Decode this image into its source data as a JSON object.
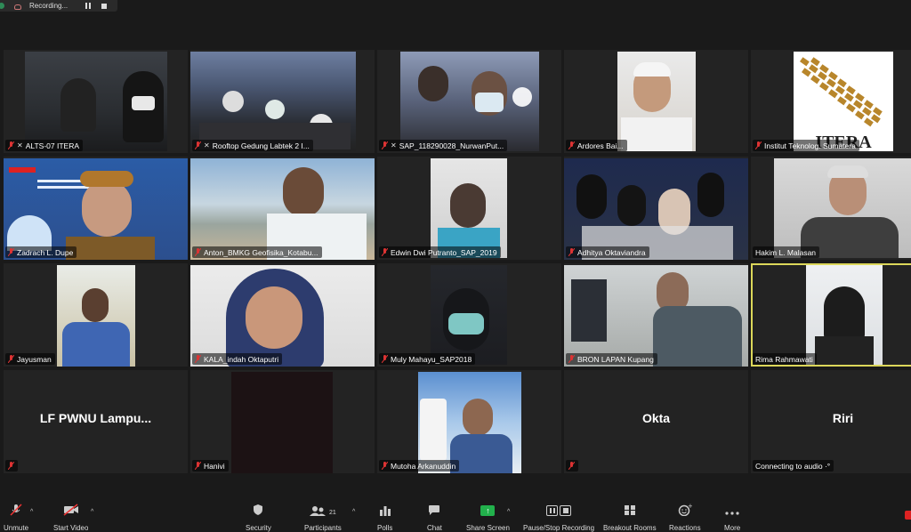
{
  "recording": {
    "label": "Recording..."
  },
  "participants": [
    {
      "name": "ALTS-07 ITERA"
    },
    {
      "name": "Rooftop Gedung Labtek 2 I..."
    },
    {
      "name": "SAP_118290028_NurwanPut..."
    },
    {
      "name": "Ardores Bai..."
    },
    {
      "name": "Institut Teknolog. Sumatera",
      "logo_text": "ITERA"
    },
    {
      "name": "Zadrach L. Dupe"
    },
    {
      "name": "Anton_BMKG Geofisika_Kotabu..."
    },
    {
      "name": "Edwin Dwi Putranto_SAP_2019"
    },
    {
      "name": "Adhitya Oktaviandra"
    },
    {
      "name": "Hakim L. Malasan"
    },
    {
      "name": "Jayusman"
    },
    {
      "name": "KALA_indah Oktaputri"
    },
    {
      "name": "Muly Mahayu_SAP2018"
    },
    {
      "name": "BRON LAPAN Kupang"
    },
    {
      "name": "Rima Rahmawati"
    },
    {
      "name": "LF PWNU Lampu..."
    },
    {
      "name": "Hanivi"
    },
    {
      "name": "Mutoha Arkanuddin"
    },
    {
      "name": "Okta"
    },
    {
      "name": "Riri",
      "status": "Connecting to audio ·°"
    }
  ],
  "toolbar": {
    "unmute": "Unmute",
    "start_video": "Start Video",
    "security": "Security",
    "participants": "Participants",
    "participants_count": "21",
    "polls": "Polls",
    "chat": "Chat",
    "share_screen": "Share Screen",
    "pause_stop_recording": "Pause/Stop Recording",
    "breakout_rooms": "Breakout Rooms",
    "reactions": "Reactions",
    "more": "More"
  },
  "colors": {
    "active_speaker": "#dcd75a",
    "share_green": "#22b14c",
    "mic_muted": "#d33"
  }
}
